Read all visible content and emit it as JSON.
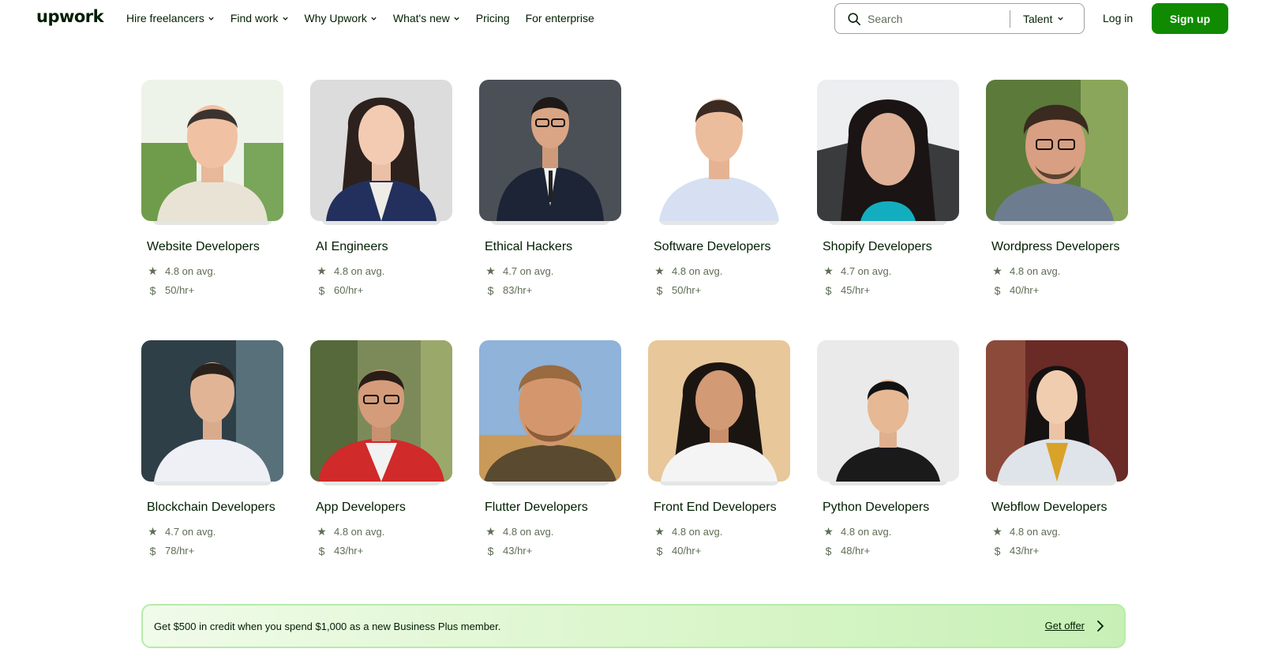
{
  "header": {
    "logo": "upwork",
    "nav": [
      {
        "label": "Hire freelancers",
        "dropdown": true
      },
      {
        "label": "Find work",
        "dropdown": true
      },
      {
        "label": "Why Upwork",
        "dropdown": true
      },
      {
        "label": "What's new",
        "dropdown": true
      },
      {
        "label": "Pricing",
        "dropdown": false
      },
      {
        "label": "For enterprise",
        "dropdown": false
      }
    ],
    "search": {
      "placeholder": "Search",
      "category": "Talent"
    },
    "login_label": "Log in",
    "signup_label": "Sign up"
  },
  "categories": [
    {
      "title": "Website Developers",
      "rating": "4.8 on avg.",
      "rate": "50/hr+"
    },
    {
      "title": "AI Engineers",
      "rating": "4.8 on avg.",
      "rate": "60/hr+"
    },
    {
      "title": "Ethical Hackers",
      "rating": "4.7 on avg.",
      "rate": "83/hr+"
    },
    {
      "title": "Software Developers",
      "rating": "4.8 on avg.",
      "rate": "50/hr+"
    },
    {
      "title": "Shopify Developers",
      "rating": "4.7 on avg.",
      "rate": "45/hr+"
    },
    {
      "title": "Wordpress Developers",
      "rating": "4.8 on avg.",
      "rate": "40/hr+"
    },
    {
      "title": "Blockchain Developers",
      "rating": "4.7 on avg.",
      "rate": "78/hr+"
    },
    {
      "title": "App Developers",
      "rating": "4.8 on avg.",
      "rate": "43/hr+"
    },
    {
      "title": "Flutter Developers",
      "rating": "4.8 on avg.",
      "rate": "43/hr+"
    },
    {
      "title": "Front End Developers",
      "rating": "4.8 on avg.",
      "rate": "40/hr+"
    },
    {
      "title": "Python Developers",
      "rating": "4.8 on avg.",
      "rate": "48/hr+"
    },
    {
      "title": "Webflow Developers",
      "rating": "4.8 on avg.",
      "rate": "43/hr+"
    }
  ],
  "banner": {
    "text": "Get $500 in credit when you spend $1,000 as a new Business Plus member.",
    "link_label": "Get offer"
  },
  "icons": {
    "rating": "star-icon",
    "rate": "dollar-icon"
  },
  "colors": {
    "brand": "#108a00",
    "text": "#001e00",
    "muted": "#5e6d55"
  }
}
